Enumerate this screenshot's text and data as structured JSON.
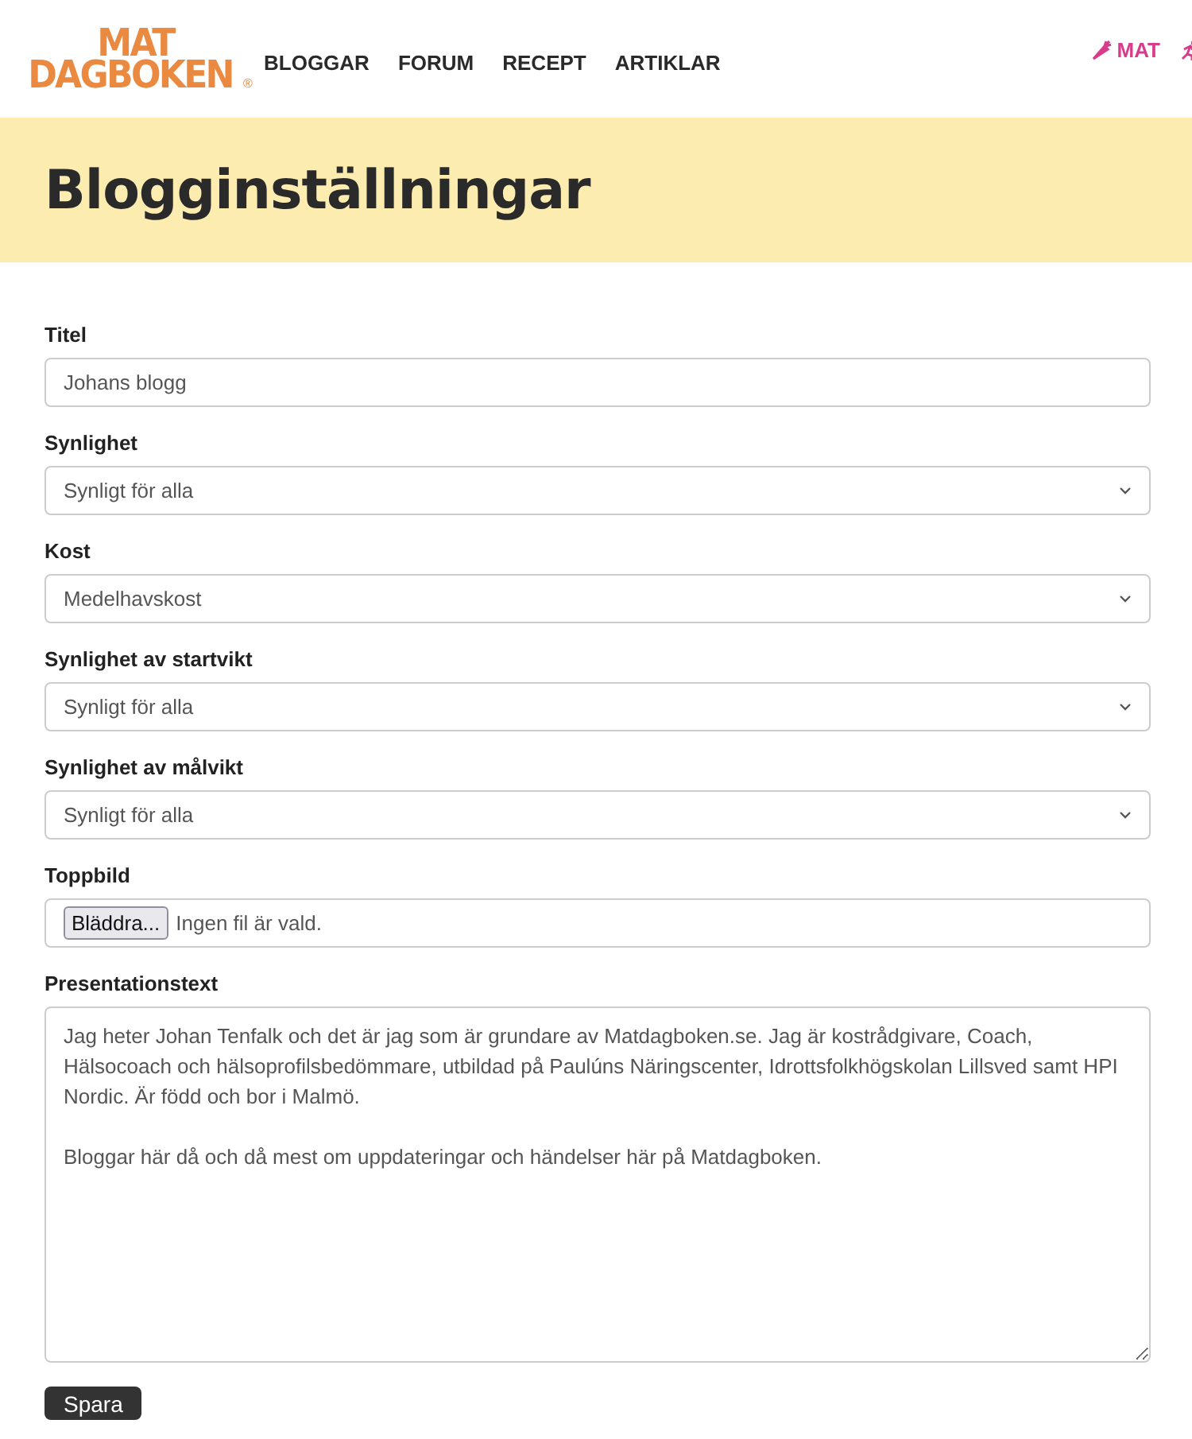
{
  "logo": {
    "lines": [
      "MAT",
      "DAGBOKEN"
    ],
    "mark": "®"
  },
  "nav": [
    "BLOGGAR",
    "FORUM",
    "RECEPT",
    "ARTIKLAR"
  ],
  "right_nav": [
    {
      "label": "MAT",
      "kind": "carrot"
    }
  ],
  "page_title": "Blogginställningar",
  "fields": [
    {
      "label": "Titel",
      "kind": "text",
      "value": "Johans blogg"
    },
    {
      "label": "Synlighet",
      "kind": "select",
      "value": "Synligt för alla"
    },
    {
      "label": "Kost",
      "kind": "select",
      "value": "Medelhavskost"
    },
    {
      "label": "Synlighet av startvikt",
      "kind": "select",
      "value": "Synligt för alla"
    },
    {
      "label": "Synlighet av målvikt",
      "kind": "select",
      "value": "Synligt för alla"
    },
    {
      "label": "Toppbild",
      "kind": "file",
      "button": "Bläddra...",
      "file_status": "Ingen fil är vald."
    },
    {
      "label": "Presentationstext",
      "kind": "textarea",
      "value": "Jag heter Johan Tenfalk och det är jag som är grundare av Matdagboken.se. Jag är kostrådgivare, Coach, Hälsocoach och hälsoprofilsbedömmare, utbildad på Paulúns Näringscenter, Idrottsfolkhögskolan Lillsved samt HPI Nordic. Är född och bor i Malmö.\n\nBloggar här då och då mest om uppdateringar och händelser här på Matdagboken."
    }
  ],
  "submit": "Spara"
}
